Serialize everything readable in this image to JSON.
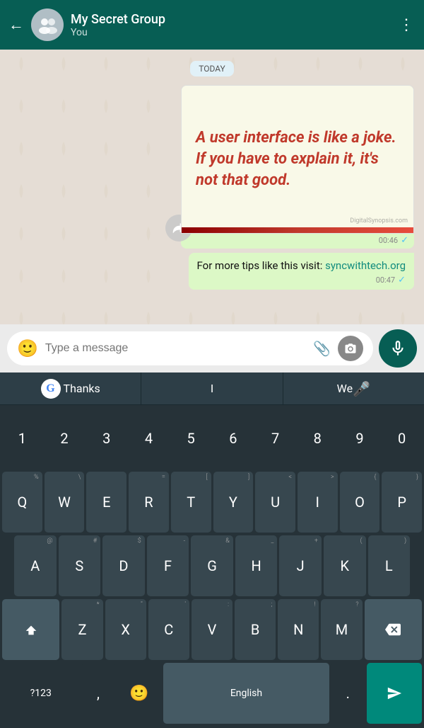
{
  "header": {
    "back_label": "←",
    "title": "My Secret Group",
    "subtitle": "You",
    "menu_label": "⋮"
  },
  "chat": {
    "date_badge": "TODAY",
    "quote_text": "A user interface is like a joke. If you have to explain it, it's not that good.",
    "quote_watermark": "DigitalSynopsis.com",
    "image_time": "00:46",
    "text_message": "For more tips like this visit: ",
    "text_link": "syncwithtech.org",
    "text_time": "00:47"
  },
  "input": {
    "placeholder": "Type a message"
  },
  "suggestions": {
    "item1": "Thanks",
    "item2": "I",
    "item3": "We"
  },
  "keyboard": {
    "row_numbers": [
      "1",
      "2",
      "3",
      "4",
      "5",
      "6",
      "7",
      "8",
      "9",
      "0"
    ],
    "row1": [
      "Q",
      "W",
      "E",
      "R",
      "T",
      "Y",
      "U",
      "I",
      "O",
      "P"
    ],
    "row1_sub": [
      "%",
      "\\",
      "",
      "=",
      "[",
      "]",
      "<",
      ">",
      "{",
      "}"
    ],
    "row2": [
      "A",
      "S",
      "D",
      "F",
      "G",
      "H",
      "J",
      "K",
      "L"
    ],
    "row2_sub": [
      "@",
      "#",
      "$",
      "-",
      "&",
      "_",
      "+",
      "(",
      ")"
    ],
    "row3": [
      "Z",
      "X",
      "C",
      "V",
      "B",
      "N",
      "M"
    ],
    "row3_sub": [
      "*",
      "\"",
      "'",
      ":",
      ";",
      "!",
      "?"
    ],
    "bottom_left": "?123",
    "bottom_space": "English",
    "bottom_period": ".",
    "bottom_send": "➤"
  }
}
